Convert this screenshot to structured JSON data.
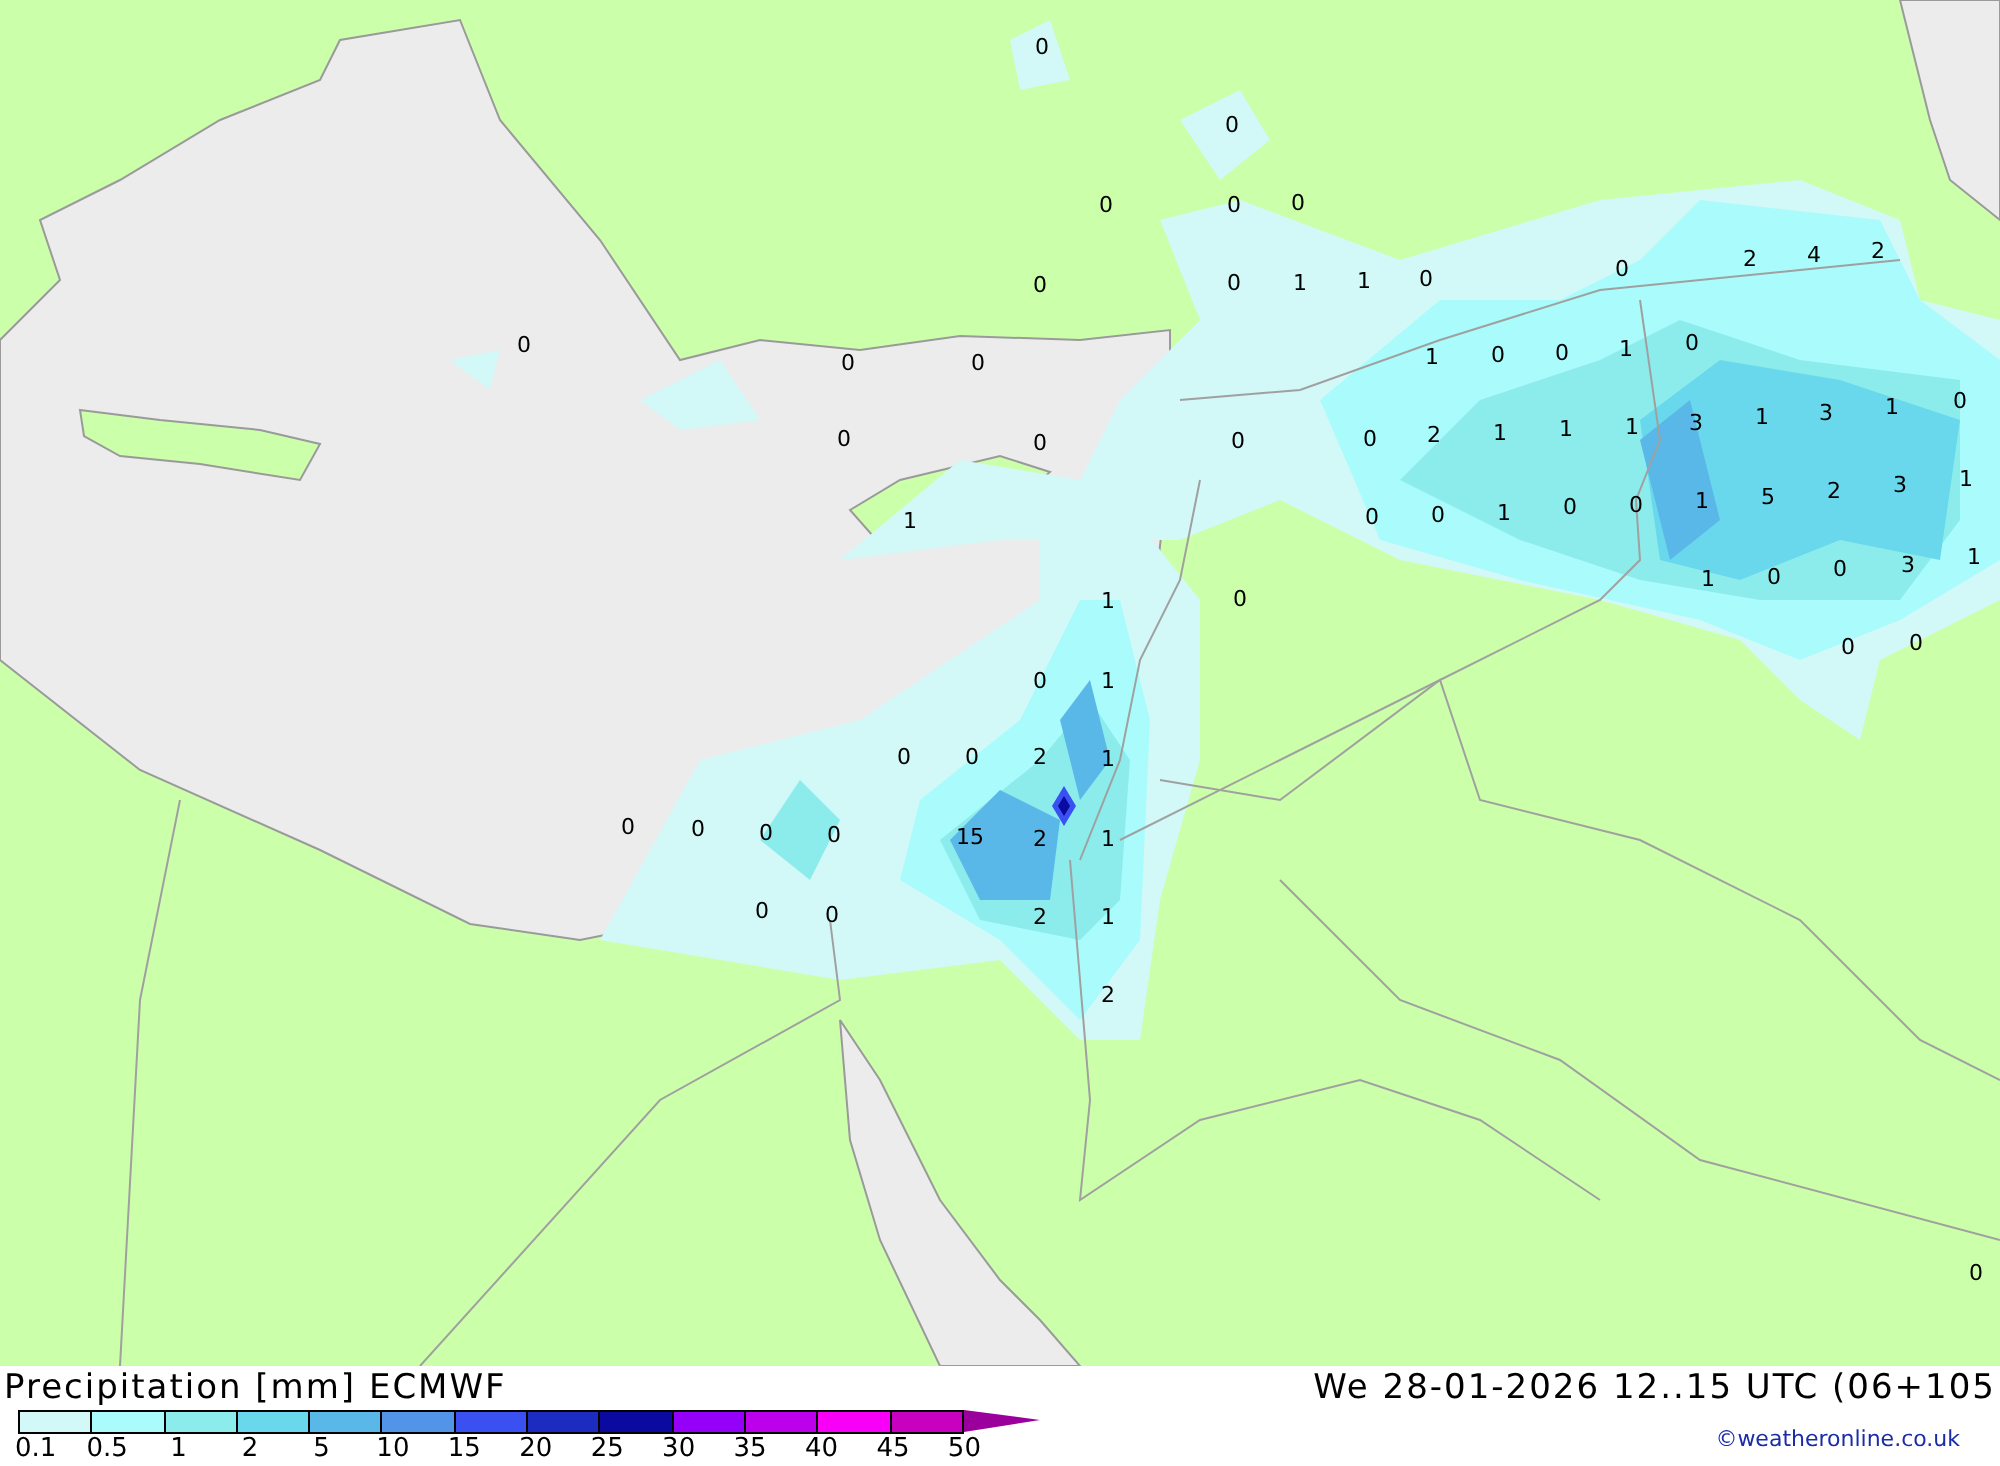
{
  "map": {
    "labels": [
      "0",
      "0",
      "0",
      "0",
      "0",
      "0",
      "0",
      "1",
      "1",
      "0",
      "0",
      "2",
      "4",
      "2",
      "0",
      "0",
      "0",
      "1",
      "0",
      "0",
      "1",
      "0",
      "0",
      "0",
      "0",
      "0",
      "2",
      "1",
      "1",
      "1",
      "3",
      "1",
      "3",
      "1",
      "0",
      "1",
      "0",
      "0",
      "1",
      "0",
      "0",
      "1",
      "5",
      "2",
      "3",
      "1",
      "1",
      "0",
      "0",
      "3",
      "1",
      "0",
      "1",
      "0",
      "0",
      "0",
      "1",
      "0",
      "0",
      "2",
      "1",
      "0",
      "0",
      "0",
      "0",
      "15",
      "2",
      "1",
      "0",
      "0",
      "2",
      "1",
      "2",
      "0"
    ]
  },
  "footer": {
    "title": "Precipitation [mm] ECMWF",
    "valid": "We 28-01-2026 12..15 UTC (06+105",
    "credit": "©weatheronline.co.uk",
    "legend": {
      "bins": [
        {
          "color": "#d2f8f8"
        },
        {
          "color": "#aafcfc"
        },
        {
          "color": "#8cecec"
        },
        {
          "color": "#6ad8ec"
        },
        {
          "color": "#5ab8e8"
        },
        {
          "color": "#5294e8"
        },
        {
          "color": "#3a50f0"
        },
        {
          "color": "#1c2cc0"
        },
        {
          "color": "#0a0aa0"
        },
        {
          "color": "#9400f8"
        },
        {
          "color": "#bc00ec"
        },
        {
          "color": "#f800f8"
        },
        {
          "color": "#c800c0"
        }
      ],
      "ticks": [
        "0.1",
        "0.5",
        "1",
        "2",
        "5",
        "10",
        "15",
        "20",
        "25",
        "30",
        "35",
        "40",
        "45",
        "50"
      ]
    }
  }
}
